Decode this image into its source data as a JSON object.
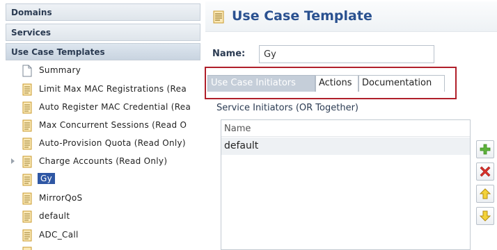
{
  "sidebar": {
    "sections": [
      {
        "label": "Domains"
      },
      {
        "label": "Services"
      },
      {
        "label": "Use Case Templates"
      }
    ],
    "tree_items": [
      {
        "label": "Summary",
        "icon": "page-blank-icon"
      },
      {
        "label": "Limit Max MAC Registrations (Rea",
        "icon": "document-icon"
      },
      {
        "label": "Auto Register MAC Credential (Rea",
        "icon": "document-icon"
      },
      {
        "label": "Max Concurrent Sessions (Read O",
        "icon": "document-icon"
      },
      {
        "label": "Auto-Provision Quota (Read Only)",
        "icon": "document-icon"
      },
      {
        "label": "Charge Accounts (Read Only)",
        "icon": "document-icon",
        "expandable": true
      },
      {
        "label": "Gy",
        "icon": "document-icon",
        "selected": true
      },
      {
        "label": "MirrorQoS",
        "icon": "document-icon"
      },
      {
        "label": "default",
        "icon": "document-icon"
      },
      {
        "label": "ADC_Call",
        "icon": "document-icon"
      }
    ]
  },
  "main": {
    "title": "Use Case Template",
    "name_label": "Name:",
    "name_value": "Gy",
    "tabs": [
      {
        "label": "Use Case Initiators",
        "active": true
      },
      {
        "label": "Actions"
      },
      {
        "label": "Documentation"
      }
    ],
    "section_title": "Service Initiators (OR Together)",
    "list": {
      "header": "Name",
      "rows": [
        "default"
      ]
    },
    "buttons": [
      "add-icon",
      "delete-icon",
      "move-up-icon",
      "move-down-icon"
    ]
  },
  "colors": {
    "accent": "#2a5190",
    "selection": "#2f57a4",
    "highlight_box": "#b01f2a",
    "doc_icon": "#e8b84a"
  }
}
